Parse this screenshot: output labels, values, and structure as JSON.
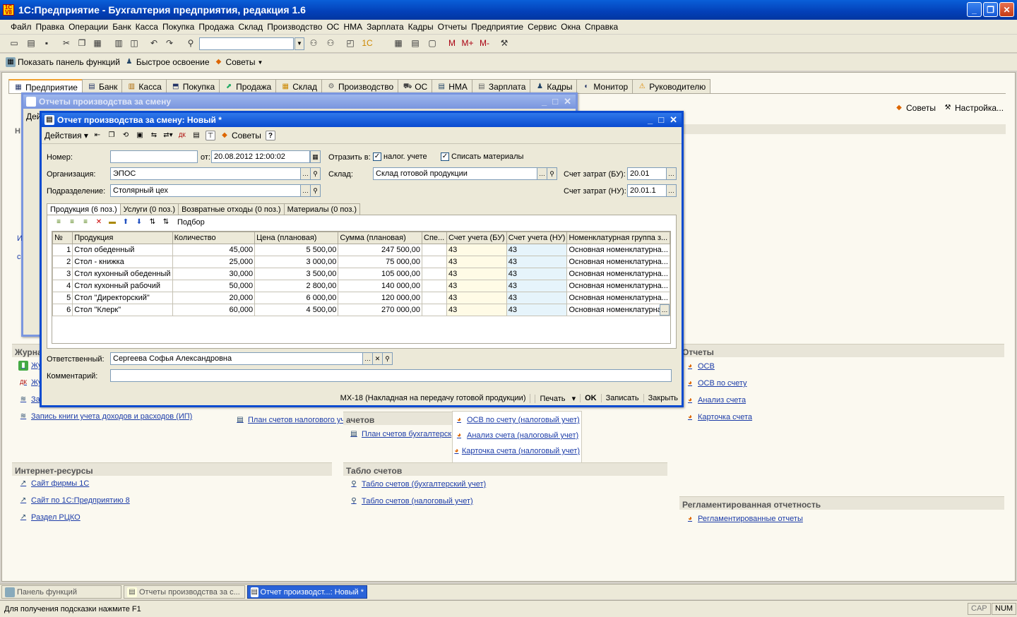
{
  "app": {
    "title": "1С:Предприятие - Бухгалтерия предприятия, редакция 1.6",
    "icon_label": "1C V8"
  },
  "menu": [
    "Файл",
    "Правка",
    "Операции",
    "Банк",
    "Касса",
    "Покупка",
    "Продажа",
    "Склад",
    "Производство",
    "ОС",
    "НМА",
    "Зарплата",
    "Кадры",
    "Отчеты",
    "Предприятие",
    "Сервис",
    "Окна",
    "Справка"
  ],
  "toolbar2": {
    "show_panel": "Показать панель функций",
    "quick_learn": "Быстрое освоение",
    "tips": "Советы"
  },
  "func_tabs": [
    "Предприятие",
    "Банк",
    "Касса",
    "Покупка",
    "Продажа",
    "Склад",
    "Производство",
    "ОС",
    "НМА",
    "Зарплата",
    "Кадры",
    "Монитор",
    "Руководителю"
  ],
  "right_tools": {
    "tips": "Советы",
    "settings": "Настройка..."
  },
  "bg_panels": {
    "journals_hdr": "Журна",
    "journal_links": [
      "Жу",
      "Жу",
      "Зап"
    ],
    "kudir": "Запись книги учета доходов и расходов (ИП)",
    "plan_nu": "План счетов налогового учета",
    "plan_bu": "План счетов бухгалтерск",
    "plans_hdr": "ачетов",
    "tax_reports": [
      "ОСВ по счету (налоговый учет)",
      "Анализ счета (налоговый учет)",
      "Карточка счета (налоговый учет)"
    ],
    "reports_hdr": "Отчеты",
    "reports": [
      "ОСВ",
      "ОСВ по счету",
      "Анализ счета",
      "Карточка счета"
    ],
    "internet_hdr": "Интернет-ресурсы",
    "internet": [
      "Сайт фирмы 1С",
      "Сайт по 1С:Предприятию 8",
      "Раздел РЦКО"
    ],
    "tablo_hdr": "Табло счетов",
    "tablo": [
      "Табло счетов (бухгалтерский учет)",
      "Табло счетов (налоговый учет)"
    ],
    "reg_hdr": "Регламентированная отчетность",
    "reg": [
      "Регламентированные отчеты"
    ],
    "side_letters": [
      "Н",
      "И",
      "с"
    ]
  },
  "list_window": {
    "title": "Отчеты производства за смену",
    "actions": "Дей"
  },
  "doc": {
    "title": "Отчет производства за смену: Новый *",
    "actions": "Действия",
    "tips": "Советы",
    "help": "?",
    "labels": {
      "number": "Номер:",
      "from": "от:",
      "reflect": "Отразить в:",
      "tax": "налог. учете",
      "write_off": "Списать материалы",
      "org": "Организация:",
      "warehouse": "Склад:",
      "cost_bu": "Счет затрат (БУ):",
      "dept": "Подразделение:",
      "cost_nu": "Счет затрат (НУ):",
      "responsible": "Ответственный:",
      "comment": "Комментарий:",
      "pick": "Подбор"
    },
    "values": {
      "number": "",
      "date": "20.08.2012 12:00:02",
      "org": "ЭПОС",
      "warehouse": "Склад готовой продукции",
      "cost_bu": "20.01",
      "dept": "Столярный цех",
      "cost_nu": "20.01.1",
      "responsible": "Сергеева Софья Александровна",
      "comment": ""
    },
    "tabs": [
      "Продукция (6 поз.)",
      "Услуги (0 поз.)",
      "Возвратные отходы (0 поз.)",
      "Материалы (0 поз.)"
    ],
    "columns": [
      "№",
      "Продукция",
      "Количество",
      "Цена (плановая)",
      "Сумма (плановая)",
      "Спе...",
      "Счет учета (БУ)",
      "Счет учета (НУ)",
      "Номенклатурная группа з..."
    ],
    "rows": [
      [
        "1",
        "Стол обеденный",
        "45,000",
        "5 500,00",
        "247 500,00",
        "",
        "43",
        "43",
        "Основная номенклатурна..."
      ],
      [
        "2",
        "Стол - книжка",
        "25,000",
        "3 000,00",
        "75 000,00",
        "",
        "43",
        "43",
        "Основная номенклатурна..."
      ],
      [
        "3",
        "Стол кухонный обеденный",
        "30,000",
        "3 500,00",
        "105 000,00",
        "",
        "43",
        "43",
        "Основная номенклатурна..."
      ],
      [
        "4",
        "Стол кухонный рабочий",
        "50,000",
        "2 800,00",
        "140 000,00",
        "",
        "43",
        "43",
        "Основная номенклатурна..."
      ],
      [
        "5",
        "Стол \"Директорский\"",
        "20,000",
        "6 000,00",
        "120 000,00",
        "",
        "43",
        "43",
        "Основная номенклатурна..."
      ],
      [
        "6",
        "Стол \"Клерк\"",
        "60,000",
        "4 500,00",
        "270 000,00",
        "",
        "43",
        "43",
        "Основная номенклатурна"
      ]
    ],
    "bottom_buttons": {
      "mx18": "МХ-18 (Накладная на передачу готовой продукции)",
      "print": "Печать",
      "ok": "OK",
      "save": "Записать",
      "close": "Закрыть"
    }
  },
  "taskbar": [
    "Панель функций",
    "Отчеты производства за с...",
    "Отчет производст...: Новый *"
  ],
  "status": {
    "hint": "Для получения подсказки нажмите F1",
    "cap": "CAP",
    "num": "NUM"
  }
}
